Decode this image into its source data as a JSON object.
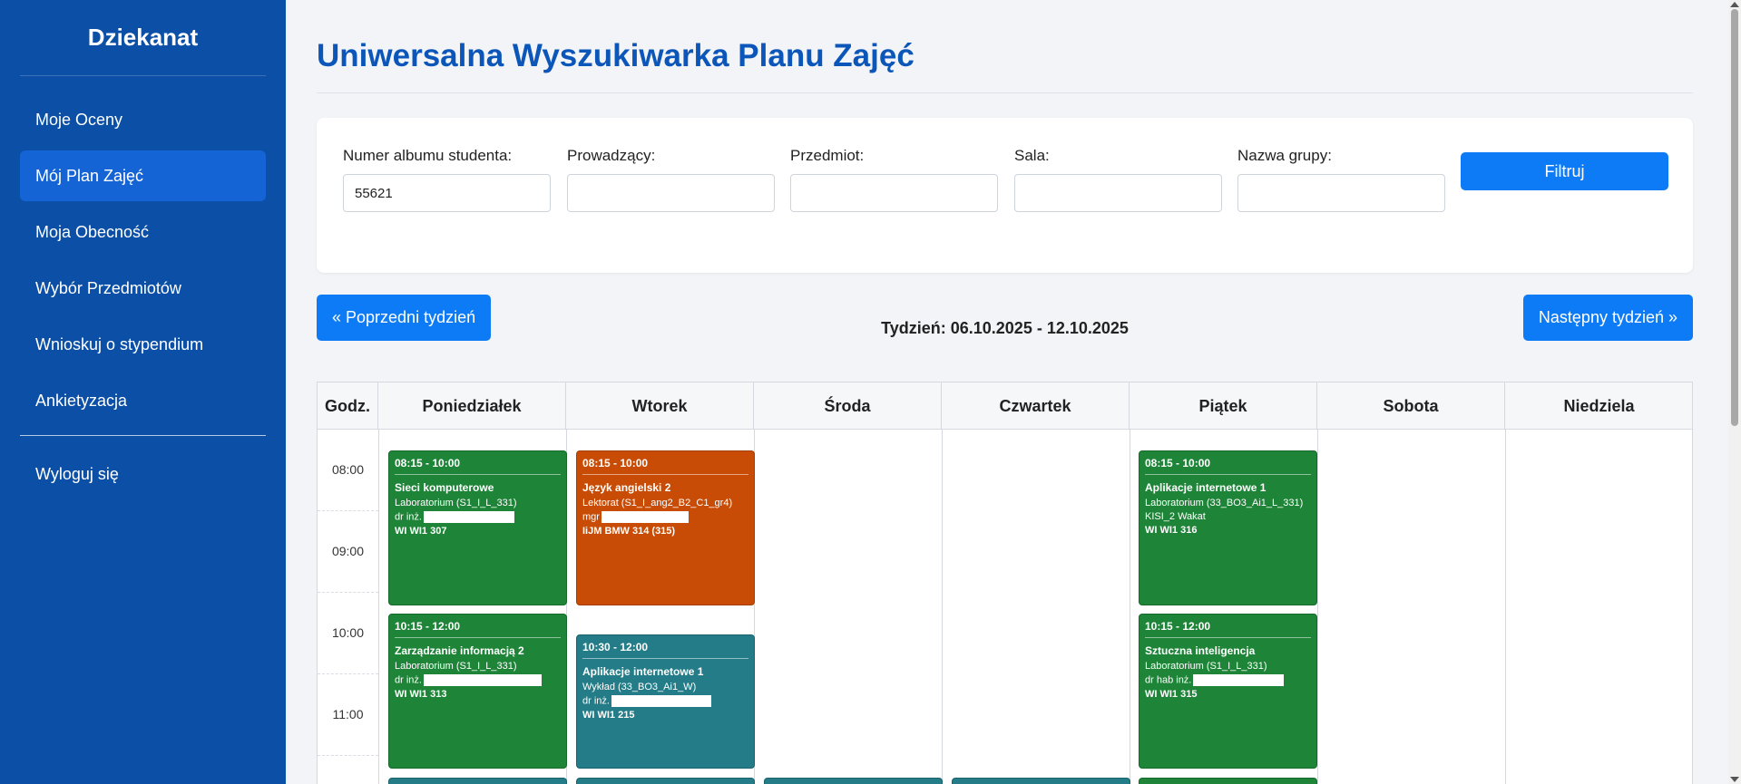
{
  "app": {
    "brand": "Dziekanat"
  },
  "sidebar": {
    "items": [
      {
        "label": "Moje Oceny"
      },
      {
        "label": "Mój Plan Zajęć"
      },
      {
        "label": "Moja Obecność"
      },
      {
        "label": "Wybór Przedmiotów"
      },
      {
        "label": "Wnioskuj o stypendium"
      },
      {
        "label": "Ankietyzacja"
      }
    ],
    "logout": "Wyloguj się",
    "active_index": 1
  },
  "page": {
    "title": "Uniwersalna Wyszukiwarka Planu Zajęć"
  },
  "filters": {
    "album": {
      "label": "Numer albumu studenta:",
      "value": "55621"
    },
    "teacher": {
      "label": "Prowadzący:",
      "value": ""
    },
    "subject": {
      "label": "Przedmiot:",
      "value": ""
    },
    "room": {
      "label": "Sala:",
      "value": ""
    },
    "group": {
      "label": "Nazwa grupy:",
      "value": ""
    },
    "button": "Filtruj"
  },
  "week": {
    "prev": "« Poprzedni tydzień",
    "next": "Następny tydzień »",
    "label": "Tydzień: 06.10.2025 - 12.10.2025"
  },
  "schedule": {
    "hour_header": "Godz.",
    "days": [
      "Poniedziałek",
      "Wtorek",
      "Środa",
      "Czwartek",
      "Piątek",
      "Sobota",
      "Niedziela"
    ],
    "hours": [
      "08:00",
      "09:00",
      "10:00",
      "11:00"
    ],
    "events": [
      {
        "day": "Poniedziałek",
        "time": "08:15 - 10:00",
        "title": "Sieci komputerowe",
        "type": "Laboratorium (S1_I_L_331)",
        "teacher": "dr inż.",
        "room": "WI WI1 307",
        "color": "green"
      },
      {
        "day": "Poniedziałek",
        "time": "10:15 - 12:00",
        "title": "Zarządzanie informacją 2",
        "type": "Laboratorium (S1_I_L_331)",
        "teacher": "dr inż.",
        "room": "WI WI1 313",
        "color": "green"
      },
      {
        "day": "Wtorek",
        "time": "08:15 - 10:00",
        "title": "Język angielski 2",
        "type": "Lektorat (S1_I_ang2_B2_C1_gr4)",
        "teacher": "mgr",
        "room": "IiJM BMW 314 (315)",
        "color": "orange"
      },
      {
        "day": "Wtorek",
        "time": "10:30 - 12:00",
        "title": "Aplikacje internetowe 1",
        "type": "Wykład (33_BO3_Ai1_W)",
        "teacher": "dr inż.",
        "room": "WI WI1 215",
        "color": "teal"
      },
      {
        "day": "Piątek",
        "time": "08:15 - 10:00",
        "title": "Aplikacje internetowe 1",
        "type": "Laboratorium (33_BO3_Ai1_L_331)",
        "teacher": "KISI_2 Wakat",
        "room": "WI WI1 316",
        "color": "green"
      },
      {
        "day": "Piątek",
        "time": "10:15 - 12:00",
        "title": "Sztuczna inteligencja",
        "type": "Laboratorium (S1_I_L_331)",
        "teacher": "dr hab inż.",
        "room": "WI WI1 315",
        "color": "green"
      }
    ]
  },
  "colors": {
    "sidebar": "#0b4fa6",
    "accent": "#0d7bf5",
    "title": "#0b56b8",
    "green": "#1e8538",
    "orange": "#c84c05",
    "teal": "#237c87"
  }
}
